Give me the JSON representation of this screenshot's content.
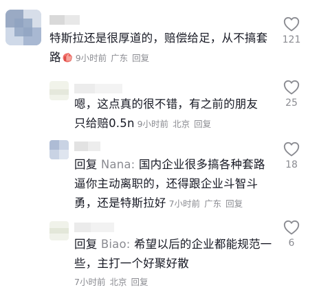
{
  "comments": [
    {
      "text_line1": "特斯拉还是很厚道的，赔偿给足，从不搞套",
      "text_line2": "路",
      "emoji_icon": "thumbs-up-emoji",
      "time": "9小时前",
      "location": "广东",
      "reply_label": "回复",
      "likes": "121"
    },
    {
      "text_line1": "嗯，这点真的很不错，有之前的朋友",
      "text_line2": "只给赔0.5n",
      "time": "9小时前",
      "location": "北京",
      "reply_label": "回复",
      "likes": "25"
    },
    {
      "reply_prefix": "回复",
      "reply_to": "Nana:",
      "text_line1": "国内企业很多搞各种套路",
      "text_line2": "逼你主动离职的，还得跟企业斗智斗",
      "text_line3": "勇，还是特斯拉好",
      "time": "7小时前",
      "location": "广东",
      "reply_label": "回复",
      "likes": "18"
    },
    {
      "reply_prefix": "回复",
      "reply_to": "Biao:",
      "text_line1": "希望以后的企业都能规范一",
      "text_line2": "些，主打一个好聚好散",
      "time": "7小时前",
      "location": "北京",
      "reply_label": "回复",
      "likes": "6"
    }
  ],
  "icons": {
    "like": "heart-outline-icon"
  },
  "colors": {
    "text": "#161823",
    "meta": "#8a8b91",
    "icon": "#8a8b91"
  }
}
